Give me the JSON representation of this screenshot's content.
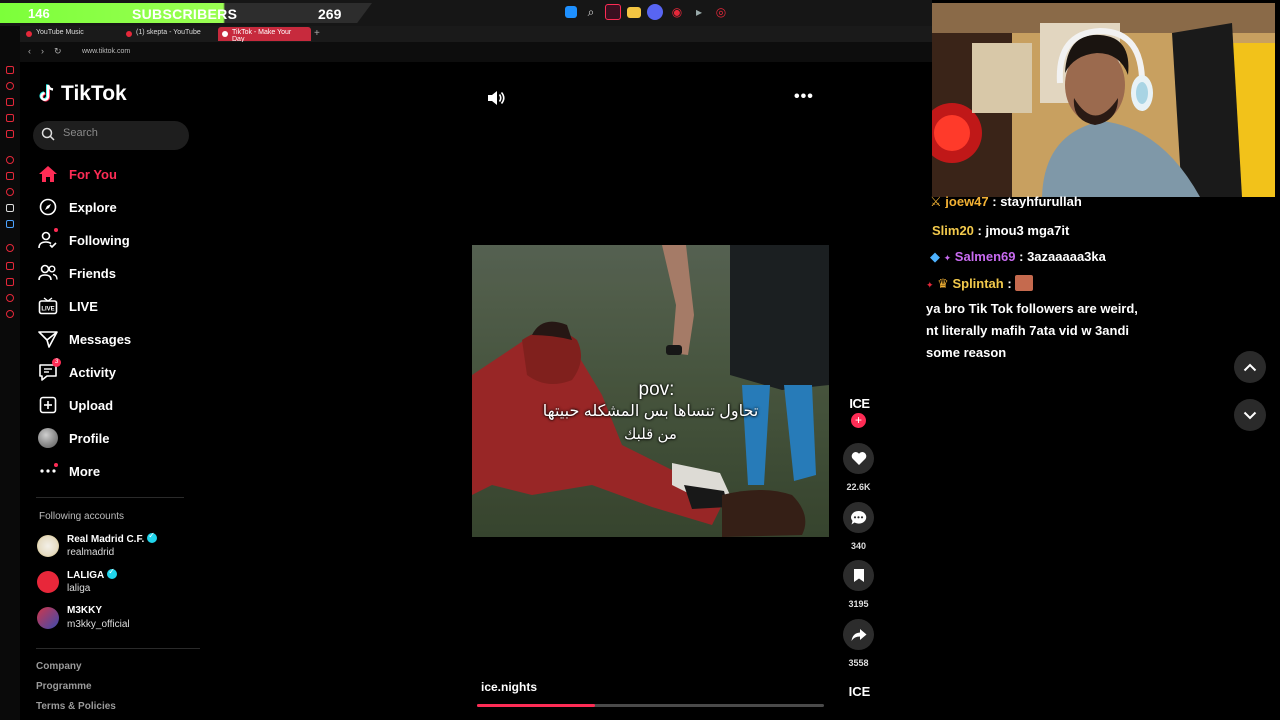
{
  "stream_overlay": {
    "subs_current": "146",
    "subs_label": "SUBSCRIBERS",
    "subs_goal": "269"
  },
  "browser": {
    "tabs": [
      {
        "label": "YouTube Music",
        "active": false
      },
      {
        "label": "(1) skepta - YouTube",
        "active": false
      },
      {
        "label": "TikTok - Make Your Day",
        "active": true
      }
    ],
    "url": "www.tiktok.com"
  },
  "tiktok": {
    "logo_text": "TikTok",
    "search_placeholder": "Search",
    "nav": [
      {
        "label": "For You",
        "icon": "home-icon",
        "active": true
      },
      {
        "label": "Explore",
        "icon": "compass-icon"
      },
      {
        "label": "Following",
        "icon": "following-icon"
      },
      {
        "label": "Friends",
        "icon": "friends-icon"
      },
      {
        "label": "LIVE",
        "icon": "live-icon"
      },
      {
        "label": "Messages",
        "icon": "messages-icon"
      },
      {
        "label": "Activity",
        "icon": "activity-icon",
        "badge": "3"
      },
      {
        "label": "Upload",
        "icon": "upload-icon"
      },
      {
        "label": "Profile",
        "icon": "profile-avatar"
      },
      {
        "label": "More",
        "icon": "more-icon"
      }
    ],
    "following_title": "Following accounts",
    "following": [
      {
        "name": "Real Madrid C.F.",
        "handle": "realmadrid",
        "verified": true
      },
      {
        "name": "LALIGA",
        "handle": "laliga",
        "verified": true
      },
      {
        "name": "M3KKY",
        "handle": "m3kky_official",
        "verified": false
      }
    ],
    "footer": [
      "Company",
      "Programme",
      "Terms & Policies"
    ]
  },
  "video": {
    "caption_pov": "pov:",
    "caption_line1": "تحاول تنساها بس المشكله حبيتها",
    "caption_line2": "من قلبك",
    "author": "ice.nights",
    "progress": 0.34,
    "creator_avatar_text": "ICE",
    "next_avatar_text": "ICE",
    "likes": "22.6K",
    "comments": "340",
    "saves": "3195",
    "shares": "3558"
  },
  "chat": [
    {
      "user": "joew47",
      "msg": "stayhfurullah",
      "color": "#f2b134"
    },
    {
      "user": "Slim20",
      "msg": "jmou3 mga7it",
      "color": "#f2c94c"
    },
    {
      "user": "Salmen69",
      "msg": "3azaaaaa3ka",
      "color": "#c86bf0"
    },
    {
      "user": "Splintah",
      "msg": "",
      "color": "#f2c94c"
    },
    {
      "user": "",
      "msg": "ya bro Tik Tok followers are weird,",
      "color": "#fff"
    },
    {
      "user": "",
      "msg": "nt literally mafih 7ata vid w 3andi",
      "color": "#fff"
    },
    {
      "user": "",
      "msg": "some reason",
      "color": "#fff"
    }
  ],
  "colors": {
    "accent": "#fe2c55",
    "subs_bar": "#8cff44",
    "verified": "#20d5ec"
  }
}
